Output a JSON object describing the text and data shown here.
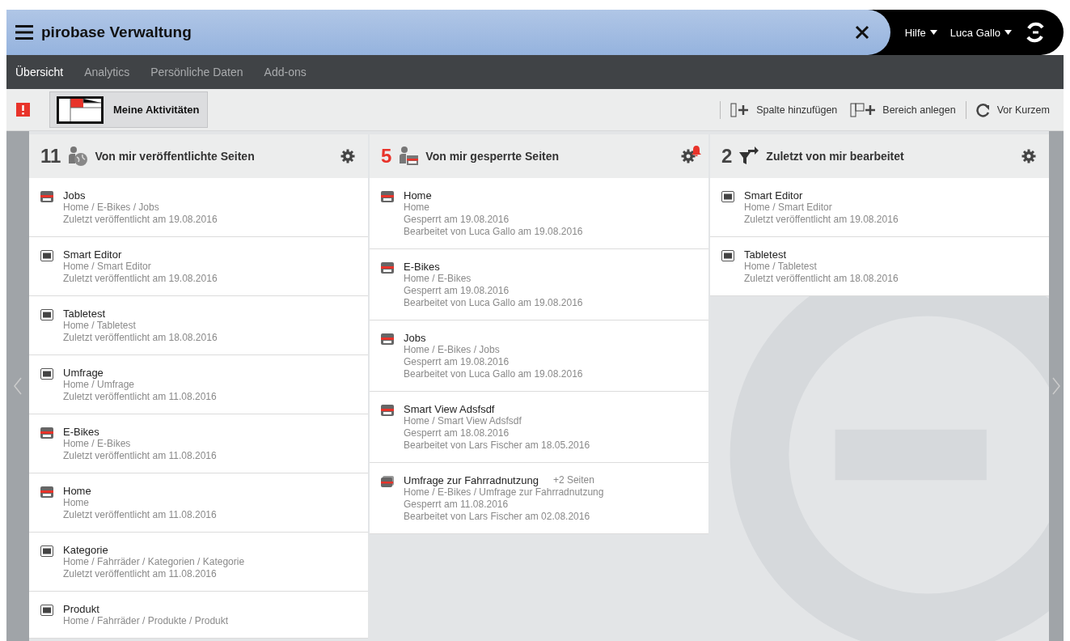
{
  "header": {
    "title": "pirobase Verwaltung",
    "help": "Hilfe",
    "user": "Luca Gallo"
  },
  "tabs": [
    {
      "label": "Übersicht",
      "selected": true
    },
    {
      "label": "Analytics",
      "selected": false
    },
    {
      "label": "Persönliche Daten",
      "selected": false
    },
    {
      "label": "Add-ons",
      "selected": false
    }
  ],
  "toolbar": {
    "view": "Meine Aktivitäten",
    "actions": [
      {
        "kind": "add-column",
        "label": "Spalte hinzufügen"
      },
      {
        "kind": "add-area",
        "label": "Bereich anlegen"
      },
      {
        "kind": "recent",
        "label": "Vor Kurzem"
      }
    ]
  },
  "columns": [
    {
      "count": "11",
      "kind": "published",
      "title": "Von mir veröffentlichte Seiten",
      "alert": false,
      "items": [
        {
          "kind": "locked",
          "title": "Jobs",
          "lines": [
            "Home / E-Bikes / Jobs",
            "Zuletzt veröffentlicht am 19.08.2016"
          ]
        },
        {
          "kind": "page",
          "title": "Smart Editor",
          "lines": [
            "Home / Smart Editor",
            "Zuletzt veröffentlicht am 19.08.2016"
          ]
        },
        {
          "kind": "page",
          "title": "Tabletest",
          "lines": [
            "Home / Tabletest",
            "Zuletzt veröffentlicht am 18.08.2016"
          ]
        },
        {
          "kind": "page",
          "title": "Umfrage",
          "lines": [
            "Home / Umfrage",
            "Zuletzt veröffentlicht am 11.08.2016"
          ]
        },
        {
          "kind": "locked",
          "title": "E-Bikes",
          "lines": [
            "Home / E-Bikes",
            "Zuletzt veröffentlicht am 11.08.2016"
          ]
        },
        {
          "kind": "locked",
          "title": "Home",
          "lines": [
            "Home",
            "Zuletzt veröffentlicht am 11.08.2016"
          ]
        },
        {
          "kind": "page",
          "title": "Kategorie",
          "lines": [
            "Home / Fahrräder / Kategorien / Kategorie",
            "Zuletzt veröffentlicht am 11.08.2016"
          ]
        },
        {
          "kind": "page",
          "title": "Produkt",
          "lines": [
            "Home / Fahrräder / Produkte / Produkt"
          ]
        }
      ]
    },
    {
      "count": "5",
      "kind": "locked",
      "title": "Von mir gesperrte Seiten",
      "alert": true,
      "items": [
        {
          "kind": "locked",
          "title": "Home",
          "lines": [
            "Home",
            "Gesperrt am 19.08.2016",
            "Bearbeitet von Luca Gallo am 19.08.2016"
          ]
        },
        {
          "kind": "locked",
          "title": "E-Bikes",
          "lines": [
            "Home / E-Bikes",
            "Gesperrt am 19.08.2016",
            "Bearbeitet von Luca Gallo am 19.08.2016"
          ]
        },
        {
          "kind": "locked",
          "title": "Jobs",
          "lines": [
            "Home / E-Bikes / Jobs",
            "Gesperrt am 19.08.2016",
            "Bearbeitet von Luca Gallo am 19.08.2016"
          ]
        },
        {
          "kind": "locked",
          "title": "Smart View Adsfsdf",
          "lines": [
            "Home / Smart View Adsfsdf",
            "Gesperrt am 18.08.2016",
            "Bearbeitet von Lars Fischer am 18.05.2016"
          ]
        },
        {
          "kind": "locked-multi",
          "title": "Umfrage zur Fahrradnutzung",
          "extra": "+2 Seiten",
          "lines": [
            "Home / E-Bikes / Umfrage zur Fahrradnutzung",
            "Gesperrt am 11.08.2016",
            "Bearbeitet von Lars Fischer am 02.08.2016"
          ]
        }
      ]
    },
    {
      "count": "2",
      "kind": "edited",
      "title": "Zuletzt von mir bearbeitet",
      "alert": false,
      "items": [
        {
          "kind": "page",
          "title": "Smart Editor",
          "lines": [
            "Home / Smart Editor",
            "Zuletzt veröffentlicht am 19.08.2016"
          ]
        },
        {
          "kind": "page",
          "title": "Tabletest",
          "lines": [
            "Home / Tabletest",
            "Zuletzt veröffentlicht am 18.08.2016"
          ]
        }
      ]
    }
  ]
}
